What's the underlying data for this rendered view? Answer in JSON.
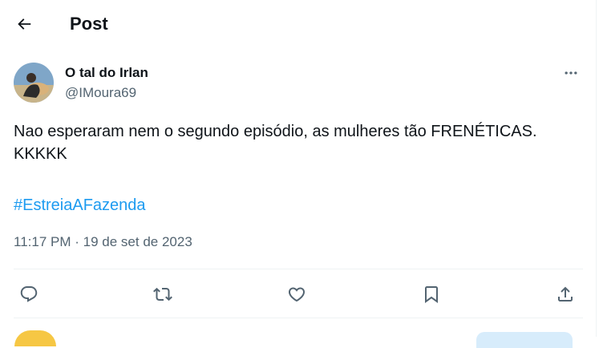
{
  "header": {
    "title": "Post",
    "back_icon": "arrow-left-icon"
  },
  "author": {
    "display_name": "O tal do Irlan",
    "handle": "@IMoura69",
    "avatar_icon": "profile-photo"
  },
  "more_icon": "more-horizontal-icon",
  "post": {
    "text": "Nao esperaram nem o segundo episódio, as mulheres tão FRENÉTICAS.\nKKKKK",
    "hashtag": "#EstreiaAFazenda",
    "time": "11:17 PM",
    "separator": "·",
    "date": "19 de set de 2023"
  },
  "actions": [
    {
      "icon": "reply-icon"
    },
    {
      "icon": "repost-icon"
    },
    {
      "icon": "like-icon"
    },
    {
      "icon": "bookmark-icon"
    },
    {
      "icon": "share-icon"
    }
  ],
  "colors": {
    "text": "#0f1419",
    "secondary": "#536471",
    "link": "#1d9bf0",
    "divider": "#eff3f4"
  }
}
